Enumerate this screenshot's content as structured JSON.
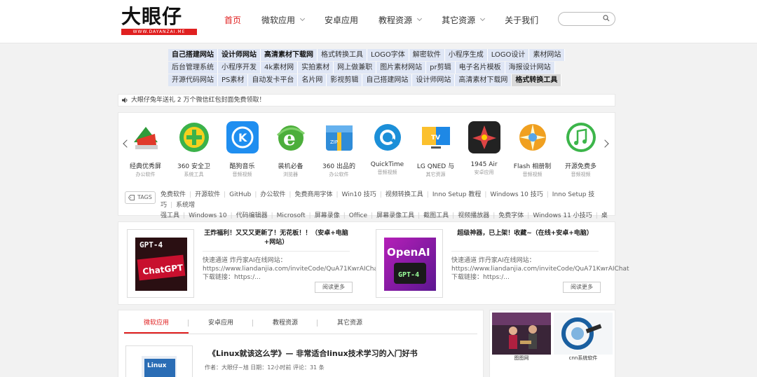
{
  "header": {
    "logo_text": "大眼仔",
    "logo_sub": "WWW.DAYANZAI.ME",
    "nav": [
      {
        "label": "首页",
        "active": true,
        "dropdown": false
      },
      {
        "label": "微软应用",
        "active": false,
        "dropdown": true
      },
      {
        "label": "安卓应用",
        "active": false,
        "dropdown": false
      },
      {
        "label": "教程资源",
        "active": false,
        "dropdown": true
      },
      {
        "label": "其它资源",
        "active": false,
        "dropdown": true
      },
      {
        "label": "关于我们",
        "active": false,
        "dropdown": false
      }
    ],
    "search_placeholder": ""
  },
  "links": {
    "rows": [
      [
        {
          "t": "自己搭建网站",
          "b": true
        },
        {
          "t": "设计师网站",
          "b": true
        },
        {
          "t": "高清素材下载网",
          "b": true
        },
        {
          "t": "格式转换工具"
        },
        {
          "t": "LOGO字体"
        },
        {
          "t": "解密软件"
        },
        {
          "t": "小程序生成"
        },
        {
          "t": "LOGO设计"
        },
        {
          "t": "素材网站"
        }
      ],
      [
        {
          "t": "后台管理系统"
        },
        {
          "t": "小程序开发"
        },
        {
          "t": "4k素材网"
        },
        {
          "t": "实拍素材"
        },
        {
          "t": "网上做兼职"
        },
        {
          "t": "图片素材网站"
        },
        {
          "t": "pr剪辑"
        },
        {
          "t": "电子名片模板"
        },
        {
          "t": "海报设计网站"
        }
      ],
      [
        {
          "t": "开源代码网站"
        },
        {
          "t": "PS素材"
        },
        {
          "t": "自动发卡平台"
        },
        {
          "t": "名片网"
        },
        {
          "t": "影视剪辑"
        },
        {
          "t": "自己搭建网站"
        },
        {
          "t": "设计师网站"
        },
        {
          "t": "高清素材下载网"
        },
        {
          "t": "格式转换工具",
          "b": true,
          "g": true
        }
      ]
    ]
  },
  "notice": "大眼仔兔年送礼 2 万个微信红包封面免费领取！",
  "apps": [
    {
      "name": "经典优秀屏",
      "cat": "办公软件"
    },
    {
      "name": "360 安全卫",
      "cat": "系统工具"
    },
    {
      "name": "酷狗音乐",
      "cat": "音频视频"
    },
    {
      "name": "装机必备",
      "cat": "浏览器"
    },
    {
      "name": "360 出品的",
      "cat": "办公软件"
    },
    {
      "name": "QuickTime",
      "cat": "音频视频"
    },
    {
      "name": "LG QNED 与",
      "cat": "其它资源"
    },
    {
      "name": "1945 Air",
      "cat": "安卓应用"
    },
    {
      "name": "Flash 相册制",
      "cat": "音频视频"
    },
    {
      "name": "开源免费多",
      "cat": "音频视频"
    }
  ],
  "tags_label": "TAGS",
  "tag_line1": [
    "免费软件",
    "开源软件",
    "GitHub",
    "办公软件",
    "免费商用字体",
    "Win10 技巧",
    "视频转换工具",
    "Inno Setup 教程",
    "Windows 10 技巧",
    "Inno Setup 技巧",
    "系统增"
  ],
  "tag_line2": [
    "强工具",
    "Windows 10",
    "代码编辑器",
    "Microsoft",
    "屏幕录像",
    "Office",
    "屏幕录像工具",
    "截图工具",
    "视频播放器",
    "免费字体",
    "Windows 11 小技巧",
    "桌面录"
  ],
  "featured": [
    {
      "title": "王炸福利！又又又更新了！无花板！！（安卓+电脑+网站）",
      "text": "快速通道 炸丹家AI在线网站：https://www.liandanjia.com/inviteCode/QuA71KwrAIChat下载链接：https:/...",
      "more": "阅读更多",
      "thumb_text": "GPT-4"
    },
    {
      "title": "超级神器，已上架！收藏~（在线+安卓+电脑）",
      "text": "快速通道 炸丹家AI在线网站：https://www.liandanjia.com/inviteCode/QuA71KwrAIChat下载链接：https:/...",
      "more": "阅读更多",
      "thumb_text": "OpenAI"
    }
  ],
  "tabs": [
    "微软应用",
    "安卓应用",
    "教程资源",
    "其它资源"
  ],
  "post": {
    "title": "《Linux就该这么学》— 非常适合linux技术学习的入门好书",
    "meta": "作者：大眼仔~旭 日期：12小时前 评论：31 条",
    "thumb_text": "Linux"
  },
  "side": [
    {
      "cap": "图图网"
    },
    {
      "cap": "cnn系统软件"
    }
  ],
  "colors": {
    "accent": "#e02020",
    "link_bg": "#dfe6f5"
  }
}
